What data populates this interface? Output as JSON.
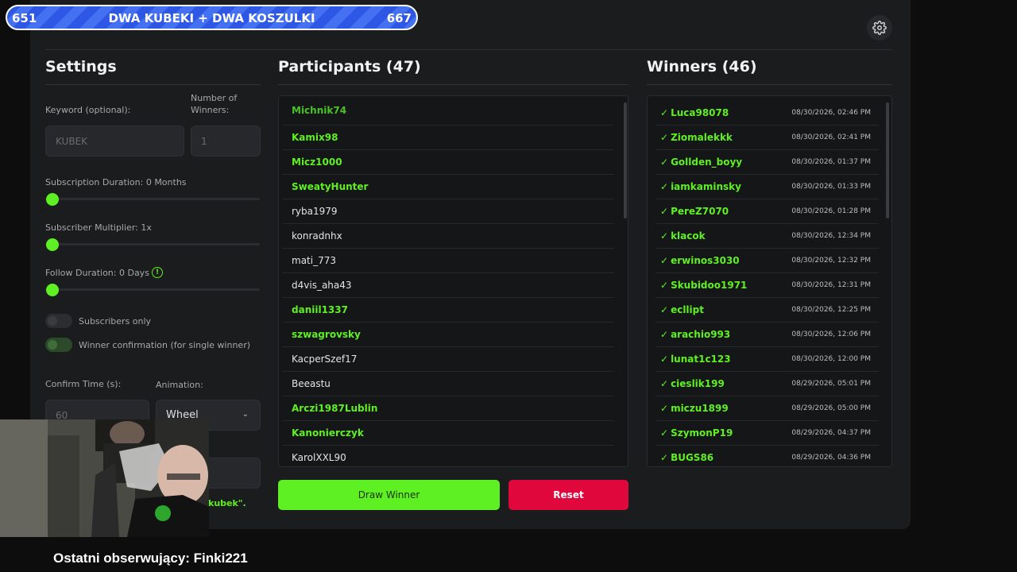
{
  "banner": {
    "left_count": "651",
    "title": "DWA KUBEKI + DWA KOSZULKI",
    "right_count": "667"
  },
  "settings": {
    "title": "Settings",
    "keyword_label": "Keyword (optional):",
    "keyword_value": "KUBEK",
    "winners_label_line1": "Number of",
    "winners_label_line2": "Winners:",
    "winners_value": "1",
    "subscription_label": "Subscription Duration: 0 Months",
    "multiplier_label": "Subscriber Multiplier: 1x",
    "follow_label": "Follow Duration:  0  Days",
    "subscribers_only_label": "Subscribers only",
    "winner_confirmation_label": "Winner confirmation (for single winner)",
    "confirm_time_label": "Confirm Time (s):",
    "confirm_time_value": "60",
    "animation_label": "Animation:",
    "animation_value": "Wheel",
    "keyword_hint_fragment": "kubek\"."
  },
  "participants": {
    "title": "Participants (47)",
    "items": [
      {
        "name": "Michnik74",
        "green": true
      },
      {
        "name": "Kamix98",
        "green": true
      },
      {
        "name": "Micz1000",
        "green": true
      },
      {
        "name": "SweatyHunter",
        "green": true
      },
      {
        "name": "ryba1979",
        "green": false
      },
      {
        "name": "konradnhx",
        "green": false
      },
      {
        "name": "mati_773",
        "green": false
      },
      {
        "name": "d4vis_aha43",
        "green": false
      },
      {
        "name": "daniil1337",
        "green": true
      },
      {
        "name": "szwagrovsky",
        "green": true
      },
      {
        "name": "KacperSzef17",
        "green": false
      },
      {
        "name": "Beeastu",
        "green": false
      },
      {
        "name": "Arczi1987Lublin",
        "green": true
      },
      {
        "name": "Kanonierczyk",
        "green": true
      },
      {
        "name": "KarolXXL90",
        "green": false
      }
    ]
  },
  "winners": {
    "title": "Winners (46)",
    "check": "✓",
    "items": [
      {
        "name": "Luca98078",
        "date": "08/30/2026, 02:46 PM"
      },
      {
        "name": "Ziomalekkk",
        "date": "08/30/2026, 02:41 PM"
      },
      {
        "name": "Gollden_boyy",
        "date": "08/30/2026, 01:37 PM"
      },
      {
        "name": "iamkaminsky",
        "date": "08/30/2026, 01:33 PM"
      },
      {
        "name": "PereZ7070",
        "date": "08/30/2026, 01:28 PM"
      },
      {
        "name": "klacok",
        "date": "08/30/2026, 12:34 PM"
      },
      {
        "name": "erwinos3030",
        "date": "08/30/2026, 12:32 PM"
      },
      {
        "name": "Skubidoo1971",
        "date": "08/30/2026, 12:31 PM"
      },
      {
        "name": "ecllipt",
        "date": "08/30/2026, 12:25 PM"
      },
      {
        "name": "arachio993",
        "date": "08/30/2026, 12:06 PM"
      },
      {
        "name": "lunat1c123",
        "date": "08/30/2026, 12:00 PM"
      },
      {
        "name": "cieslik199",
        "date": "08/29/2026, 05:01 PM"
      },
      {
        "name": "miczu1899",
        "date": "08/29/2026, 05:00 PM"
      },
      {
        "name": "SzymonP19",
        "date": "08/29/2026, 04:37 PM"
      },
      {
        "name": "BUGS86",
        "date": "08/29/2026, 04:36 PM"
      }
    ]
  },
  "buttons": {
    "draw": "Draw Winner",
    "reset": "Reset"
  },
  "footer": {
    "last_follower": "Ostatni obserwujący: Finki221"
  },
  "icons": {
    "settings": "gear-icon",
    "info": "info-icon",
    "dropdown": "chevron-down-icon"
  },
  "colors": {
    "accent": "#5ef022",
    "danger": "#e0073d",
    "banner": "#2e57e6"
  }
}
